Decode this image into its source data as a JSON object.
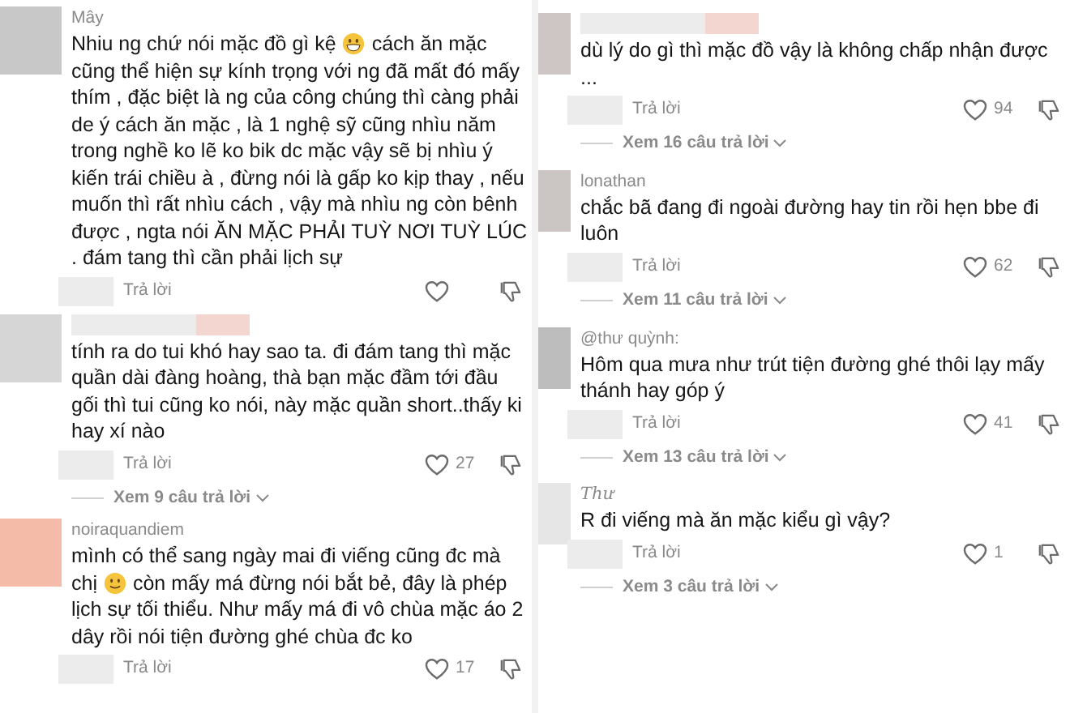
{
  "columns": [
    {
      "comments": [
        {
          "kind": "named",
          "username": "Mây",
          "color": "#c8c8c8",
          "segments": [
            {
              "kind": "inline",
              "text": "Nhiu ng chứ nói mặc đồ gì kệ"
            },
            {
              "kind": "grin"
            },
            {
              "kind": "inline",
              "text": "cách ăn mặc"
            },
            {
              "kind": "block",
              "text": "cũng thể hiện sự kính trọng với ng đã mất đó mấy thím , đặc biệt là ng của công chúng thì càng phải de ý cách ăn mặc , là 1 nghệ sỹ cũng nhìu năm trong nghề ko lẽ ko bik dc mặc vậy sẽ bị nhìu ý kiến trái chiều à , đừng nói là gấp ko kịp thay , nếu muốn thì rất nhìu cách , vậy mà nhìu ng còn bênh được , ngta nói ĂN MẶC PHẢI TUỲ NƠI TUỲ LÚC . đám tang thì cần phải lịch sự"
            }
          ],
          "reply": "Trả lời"
        },
        {
          "kind": "hidden-name",
          "color": "#d6d6d6",
          "segments": [
            {
              "kind": "block",
              "text": "tính ra do tui khó hay sao ta. đi đám tang thì mặc quần dài đàng hoàng, thà bạn mặc đầm tới đầu gối thì tui cũng ko nói, này mặc quần short..thấy ki hay xí nào"
            }
          ],
          "reply": "Trả lời",
          "likes": "27",
          "more": "Xem 9 câu trả lời"
        },
        {
          "kind": "named",
          "username": "noiraquandiem",
          "color": "#f4bba9",
          "segments": [
            {
              "kind": "block",
              "text": "mình có thể sang ngày mai đi viếng cũng đc mà"
            },
            {
              "kind": "inline",
              "text": "chị"
            },
            {
              "kind": "smile"
            },
            {
              "kind": "inline",
              "text": "còn mấy má đừng nói bắt bẻ, đây là phép"
            },
            {
              "kind": "block",
              "text": "lịch sự tối thiểu. Như mấy má đi vô chùa mặc áo 2 dây rồi nói tiện đường ghé chùa đc ko"
            }
          ],
          "reply": "Trả lời",
          "likes": "17"
        }
      ]
    },
    {
      "comments": [
        {
          "kind": "hidden-name",
          "color": "#cdc6c4",
          "segments": [
            {
              "kind": "block",
              "text": "dù lý do gì thì mặc đồ vậy là không chấp nhận được ..."
            }
          ],
          "reply": "Trả lời",
          "likes": "94",
          "more": "Xem 16 câu trả lời"
        },
        {
          "kind": "named",
          "username": "lonathan",
          "color": "#cbc5c3",
          "segments": [
            {
              "kind": "block",
              "text": "chắc bã đang đi ngoài đường hay tin rồi hẹn bbe đi luôn"
            }
          ],
          "reply": "Trả lời",
          "likes": "62",
          "more": "Xem 11 câu trả lời"
        },
        {
          "kind": "named",
          "username": "@thư quỳnh:",
          "color": "#bdbdbd",
          "segments": [
            {
              "kind": "block",
              "text": "Hôm qua mưa như trút tiện đường ghé thôi lạy mấy thánh hay góp ý"
            }
          ],
          "reply": "Trả lời",
          "likes": "41",
          "more": "Xem 13 câu trả lời"
        },
        {
          "kind": "script-name",
          "username": "Thư",
          "color": "#e6e6e6",
          "segments": [
            {
              "kind": "block",
              "text": "R đi viếng mà ăn mặc kiểu gì vậy?"
            }
          ],
          "reply": "Trả lời",
          "likes": "1",
          "more": "Xem 3 câu trả lời"
        }
      ]
    }
  ]
}
